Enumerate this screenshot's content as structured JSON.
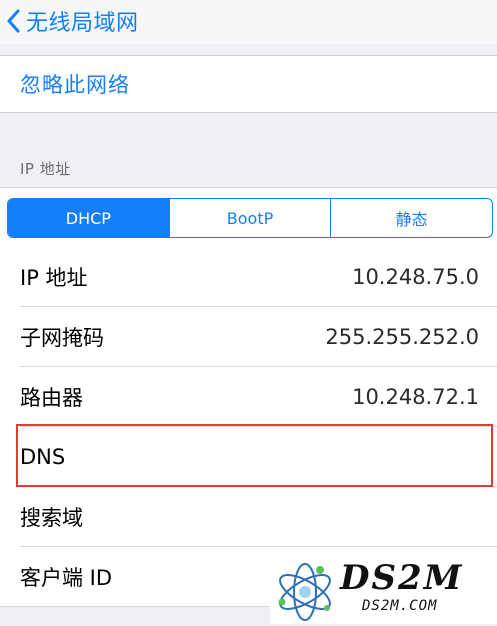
{
  "nav": {
    "back_label": "无线局域网",
    "back_icon": "chevron-left-icon"
  },
  "ignore_network": {
    "label": "忽略此网络"
  },
  "ip_section": {
    "header": "IP 地址",
    "segments": [
      {
        "label": "DHCP",
        "selected": true
      },
      {
        "label": "BootP",
        "selected": false
      },
      {
        "label": "静态",
        "selected": false
      }
    ],
    "rows": [
      {
        "label": "IP 地址",
        "value": "10.248.75.0"
      },
      {
        "label": "子网掩码",
        "value": "255.255.252.0"
      },
      {
        "label": "路由器",
        "value": "10.248.72.1"
      },
      {
        "label": "DNS",
        "value": ""
      },
      {
        "label": "搜索域",
        "value": ""
      },
      {
        "label": "客户端 ID",
        "value": ""
      }
    ]
  },
  "watermark": {
    "logo_text": "DS2M",
    "url": "DS2M.COM"
  },
  "colors": {
    "accent": "#147efb",
    "highlight_box": "#e53935",
    "background": "#efeff4"
  }
}
